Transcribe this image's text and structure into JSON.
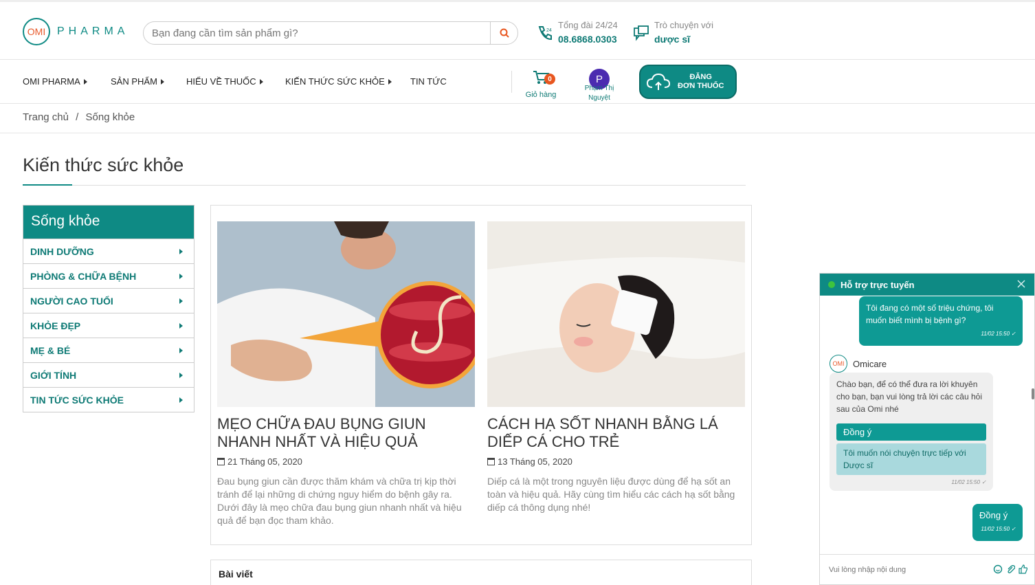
{
  "header": {
    "logo_mark": "OMI",
    "logo_text": "PHARMA",
    "search_placeholder": "Bạn đang cần tìm sản phẩm gì?",
    "hotline_label": "Tổng đài 24/24",
    "hotline_number": "08.6868.0303",
    "chat_label": "Trò chuyện với",
    "chat_target": "dược sĩ"
  },
  "nav": {
    "items": [
      "OMI PHARMA",
      "SẢN PHẨM",
      "HIỂU VỀ THUỐC",
      "KIẾN THỨC SỨC KHỎE",
      "TIN TỨC"
    ],
    "cart_count": "0",
    "cart_label": "Giỏ hàng",
    "avatar_letter": "P",
    "user_name_1": "Phạm Thị",
    "user_name_2": "Nguyệt",
    "rx_line1": "ĐĂNG",
    "rx_line2": "ĐƠN THUỐC"
  },
  "breadcrumb": {
    "home": "Trang chủ",
    "sep": "/",
    "current": "Sống khỏe"
  },
  "page_title": "Kiến thức sức khỏe",
  "sidebar": {
    "heading": "Sống khỏe",
    "items": [
      "DINH DƯỠNG",
      "PHÒNG & CHỮA BỆNH",
      "NGƯỜI CAO TUỔI",
      "KHỎE ĐẸP",
      "MẸ & BÉ",
      "GIỚI TÍNH",
      "TIN TỨC SỨC KHỎE"
    ]
  },
  "articles": [
    {
      "title": "MẸO CHỮA ĐAU BỤNG GIUN NHANH NHẤT VÀ HIỆU QUẢ",
      "date": "21 Tháng 05, 2020",
      "desc": "Đau bụng giun cần được thăm khám và chữa trị kịp thời tránh để lại những di chứng nguy hiểm do bệnh gây ra. Dưới đây là mẹo chữa đau bụng giun nhanh nhất và hiệu quả để bạn đọc tham khảo."
    },
    {
      "title": "CÁCH HẠ SỐT NHANH BẰNG LÁ DIẾP CÁ CHO TRẺ",
      "date": "13 Tháng 05, 2020",
      "desc": "Diếp cá  là một trong nguyên liệu được dùng để hạ sốt an toàn và hiệu quả. Hãy cùng tìm hiểu các cách hạ sốt bằng diếp cá thông dụng nhé!"
    }
  ],
  "posts_label": "Bài viết",
  "chat": {
    "title": "Hỗ trợ trực tuyến",
    "msg1": "Tôi đang có một số triệu chứng, tôi muốn biết mình bị bệnh gì?",
    "msg1_time": "11/02 15:50 ✓",
    "bot_name": "Omicare",
    "bot_mark": "OMI",
    "bot_msg": "Chào bạn, để có thể đưa ra lời khuyên cho bạn, bạn vui lòng trả lời các câu hỏi sau của Omi nhé",
    "option1": "Đồng ý",
    "option2": "Tôi muốn nói chuyện trực tiếp với Dược sĩ",
    "bot_time": "11/02 15:50 ✓",
    "msg2": "Đồng ý",
    "msg2_time": "11/02 15:50 ✓",
    "input_placeholder": "Vui lòng nhập nội dung"
  },
  "colors": {
    "brand": "#0e8a84",
    "accent": "#e8561f"
  }
}
